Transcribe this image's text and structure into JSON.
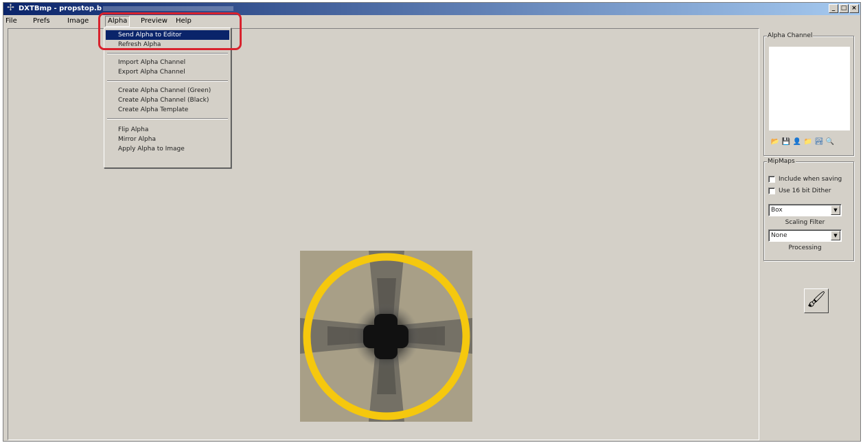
{
  "window": {
    "title": "DXTBmp - propstop.b",
    "app_icon": "dxtbmp-app-icon",
    "controls": {
      "minimize": "_",
      "maximize": "□",
      "close": "×"
    }
  },
  "menubar": {
    "items": [
      "File",
      "Prefs",
      "Image",
      "Alpha",
      "Preview",
      "Help"
    ],
    "active": "Alpha"
  },
  "alpha_menu": {
    "items": [
      "Send Alpha to Editor",
      "Refresh Alpha",
      "Import Alpha Channel",
      "Export Alpha Channel",
      "Create Alpha Channel (Green)",
      "Create Alpha Channel (Black)",
      "Create Alpha Template",
      "Flip Alpha",
      "Mirror Alpha",
      "Apply Alpha to Image"
    ],
    "selected": "Send Alpha to Editor"
  },
  "alpha_panel": {
    "title": "Alpha Channel",
    "icons": [
      "open-folder-icon",
      "save-icon",
      "person-icon",
      "folder-icon",
      "landscape-icon",
      "magnifier-icon"
    ]
  },
  "mipmaps": {
    "title": "MipMaps",
    "include_when_saving": "Include when saving",
    "use_16_bit_dither": "Use 16 bit Dither",
    "scaling_filter_value": "Box",
    "scaling_filter_label": "Scaling Filter",
    "processing_value": "None",
    "processing_label": "Processing"
  },
  "colors": {
    "highlight": "#d8222d",
    "selection": "#0a246a",
    "ring": "#f5c80e"
  }
}
